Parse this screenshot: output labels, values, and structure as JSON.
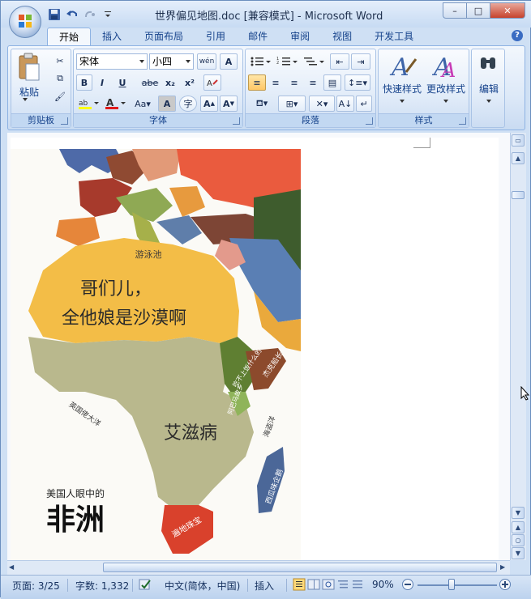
{
  "window": {
    "title": "世界偏见地图.doc [兼容模式] - Microsoft Word",
    "controls": {
      "minimize": "–",
      "maximize": "□",
      "close": "✕"
    }
  },
  "tabs": [
    "开始",
    "插入",
    "页面布局",
    "引用",
    "邮件",
    "审阅",
    "视图",
    "开发工具"
  ],
  "ribbon": {
    "clipboard": {
      "paste_label": "粘贴",
      "group_label": "剪贴板"
    },
    "font": {
      "font_name": "宋体",
      "font_size": "小四",
      "wen_label": "wén",
      "group_label": "字体",
      "buttons": [
        "B",
        "I",
        "U",
        "abe",
        "x₂",
        "x²",
        "Aa",
        "A",
        "字"
      ]
    },
    "paragraph": {
      "group_label": "段落"
    },
    "styles": {
      "quick_styles": "快速样式",
      "change_styles": "更改样式",
      "group_label": "样式"
    },
    "editing": {
      "edit_label": "编辑"
    }
  },
  "map": {
    "title_small": "美国人眼中的",
    "title_big": "非洲",
    "labels": {
      "north": "哥们儿，",
      "north2": "全他娘是沙漠啊",
      "center": "艾滋病",
      "med": "游泳池",
      "atlantic": "英国佬大洋",
      "indian": "海盗洋",
      "madagascar": "西瓜味企鹅",
      "south_africa": "遍地珠宝",
      "east1": "吃不上饭什么的",
      "east2": "阿巴马故乡",
      "horn": "杰克船长"
    }
  },
  "status": {
    "page": "页面: 3/25",
    "words": "字数: 1,332",
    "language": "中文(简体，中国)",
    "mode": "插入",
    "zoom": "90%"
  },
  "colors": {
    "accent": "#15428b",
    "ribbon_bg": "#dde9f8",
    "desert": "#f3bd47",
    "savanna": "#b9b88d",
    "south": "#d9412c"
  }
}
